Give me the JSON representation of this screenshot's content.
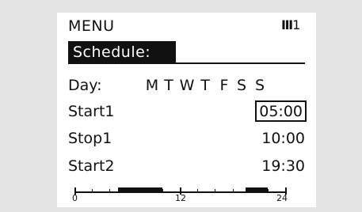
{
  "header": {
    "menu_label": "MENU",
    "system_icon": "heating-circuit-icon",
    "circuit_number": "1"
  },
  "title": "Schedule:",
  "days": {
    "label": "Day:",
    "items": [
      {
        "label": "M",
        "selected": false
      },
      {
        "label": "T",
        "selected": false
      },
      {
        "label": "W",
        "selected": false
      },
      {
        "label": "T",
        "selected": true
      },
      {
        "label": "F",
        "selected": false
      },
      {
        "label": "S",
        "selected": true
      },
      {
        "label": "S",
        "selected": false
      }
    ]
  },
  "rows": [
    {
      "label": "Start1",
      "value": "05:00",
      "focused": true
    },
    {
      "label": "Stop1",
      "value": "10:00",
      "focused": false
    },
    {
      "label": "Start2",
      "value": "19:30",
      "focused": false
    }
  ],
  "timeline": {
    "labels": [
      "0",
      "12",
      "24"
    ],
    "periods": [
      [
        5,
        10
      ],
      [
        19.5,
        22
      ]
    ]
  },
  "colors": {
    "background": "#e4e4e4",
    "screen": "#ffffff",
    "ink": "#111111"
  }
}
